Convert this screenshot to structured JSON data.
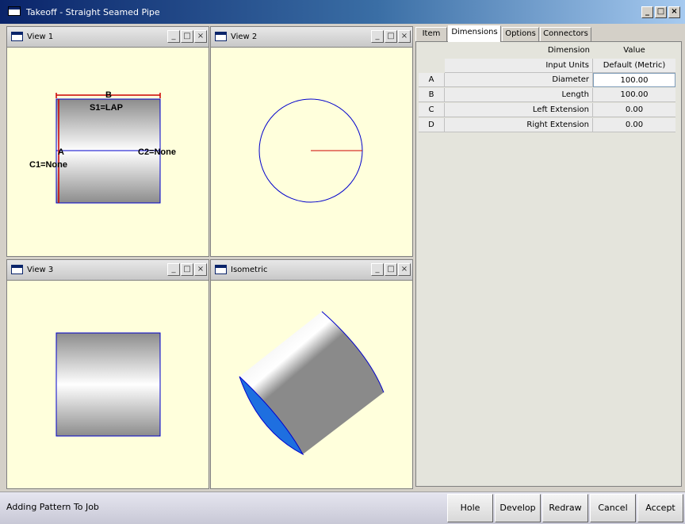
{
  "window": {
    "title": "Takeoff - Straight Seamed Pipe",
    "minimize": "_",
    "maximize": "□",
    "close": "×"
  },
  "views": [
    {
      "title": "View 1",
      "minimize": "_",
      "maximize": "□",
      "close": "×"
    },
    {
      "title": "View 2",
      "minimize": "_",
      "maximize": "□",
      "close": "×"
    },
    {
      "title": "View 3",
      "minimize": "_",
      "maximize": "□",
      "close": "×"
    },
    {
      "title": "Isometric",
      "minimize": "_",
      "maximize": "□",
      "close": "×"
    }
  ],
  "view1_labels": {
    "b": "B",
    "s1": "S1=LAP",
    "a": "A",
    "c2": "C2=None",
    "c1": "C1=None"
  },
  "tabs": [
    "Item",
    "Dimensions",
    "Options",
    "Connectors"
  ],
  "active_tab": "Dimensions",
  "grid": {
    "header": {
      "dimension": "Dimension",
      "value": "Value"
    },
    "units_row": {
      "label": "Input Units",
      "value": "Default (Metric)"
    },
    "rows": [
      {
        "letter": "A",
        "dimension": "Diameter",
        "value": "100.00"
      },
      {
        "letter": "B",
        "dimension": "Length",
        "value": "100.00"
      },
      {
        "letter": "C",
        "dimension": "Left Extension",
        "value": "0.00"
      },
      {
        "letter": "D",
        "dimension": "Right Extension",
        "value": "0.00"
      }
    ]
  },
  "status": {
    "text": "Adding Pattern To Job"
  },
  "buttons": {
    "hole": "Hole",
    "develop": "Develop",
    "redraw": "Redraw",
    "cancel": "Cancel",
    "accept": "Accept"
  },
  "colors": {
    "title_bar": "#0a246a",
    "view_background": "#ffffdc",
    "outline_blue": "#0000cc",
    "marker_red": "#cc0000",
    "iso_end_blue": "#1e6fe0"
  }
}
